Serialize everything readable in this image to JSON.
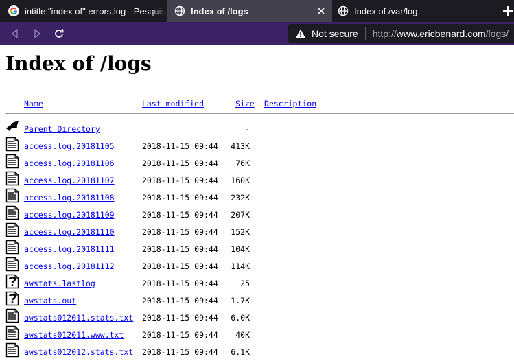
{
  "browser": {
    "tabs": [
      {
        "title": "intitle:\"index of\" errors.log - Pesquisa Google",
        "icon": "google-icon",
        "active": false
      },
      {
        "title": "Index of /logs",
        "icon": "globe-icon",
        "active": true
      },
      {
        "title": "Index of /var/log",
        "icon": "globe-icon",
        "active": false
      }
    ],
    "urlbar": {
      "security_label": "Not secure",
      "url_scheme": "http://",
      "url_host": "www.ericbenard.com",
      "url_path": "/logs/"
    }
  },
  "page": {
    "title": "Index of /logs",
    "columns": {
      "name": "Name",
      "modified": "Last modified",
      "size": "Size",
      "description": "Description"
    },
    "parent": {
      "name": "Parent Directory",
      "size": "-",
      "icon": "back-arrow-icon"
    },
    "files": [
      {
        "name": "access.log.20181105",
        "modified": "2018-11-15 09:44",
        "size": "413K",
        "icon": "text-file-icon"
      },
      {
        "name": "access.log.20181106",
        "modified": "2018-11-15 09:44",
        "size": "76K",
        "icon": "text-file-icon"
      },
      {
        "name": "access.log.20181107",
        "modified": "2018-11-15 09:44",
        "size": "160K",
        "icon": "text-file-icon"
      },
      {
        "name": "access.log.20181108",
        "modified": "2018-11-15 09:44",
        "size": "232K",
        "icon": "text-file-icon"
      },
      {
        "name": "access.log.20181109",
        "modified": "2018-11-15 09:44",
        "size": "207K",
        "icon": "text-file-icon"
      },
      {
        "name": "access.log.20181110",
        "modified": "2018-11-15 09:44",
        "size": "152K",
        "icon": "text-file-icon"
      },
      {
        "name": "access.log.20181111",
        "modified": "2018-11-15 09:44",
        "size": "104K",
        "icon": "text-file-icon"
      },
      {
        "name": "access.log.20181112",
        "modified": "2018-11-15 09:44",
        "size": "114K",
        "icon": "text-file-icon"
      },
      {
        "name": "awstats.lastlog",
        "modified": "2018-11-15 09:44",
        "size": "25",
        "icon": "unknown-file-icon"
      },
      {
        "name": "awstats.out",
        "modified": "2018-11-15 09:44",
        "size": "1.7K",
        "icon": "unknown-file-icon"
      },
      {
        "name": "awstats012011.stats.txt",
        "modified": "2018-11-15 09:44",
        "size": "6.0K",
        "icon": "text-file-icon"
      },
      {
        "name": "awstats012011.www.txt",
        "modified": "2018-11-15 09:44",
        "size": "40K",
        "icon": "text-file-icon"
      },
      {
        "name": "awstats012012.stats.txt",
        "modified": "2018-11-15 09:44",
        "size": "6.1K",
        "icon": "text-file-icon"
      }
    ]
  },
  "colors": {
    "tabbar_bg": "#1c1b22",
    "active_tab_bg": "#42414d",
    "navbar_bg": "#3b2265",
    "link": "#0000ee"
  }
}
